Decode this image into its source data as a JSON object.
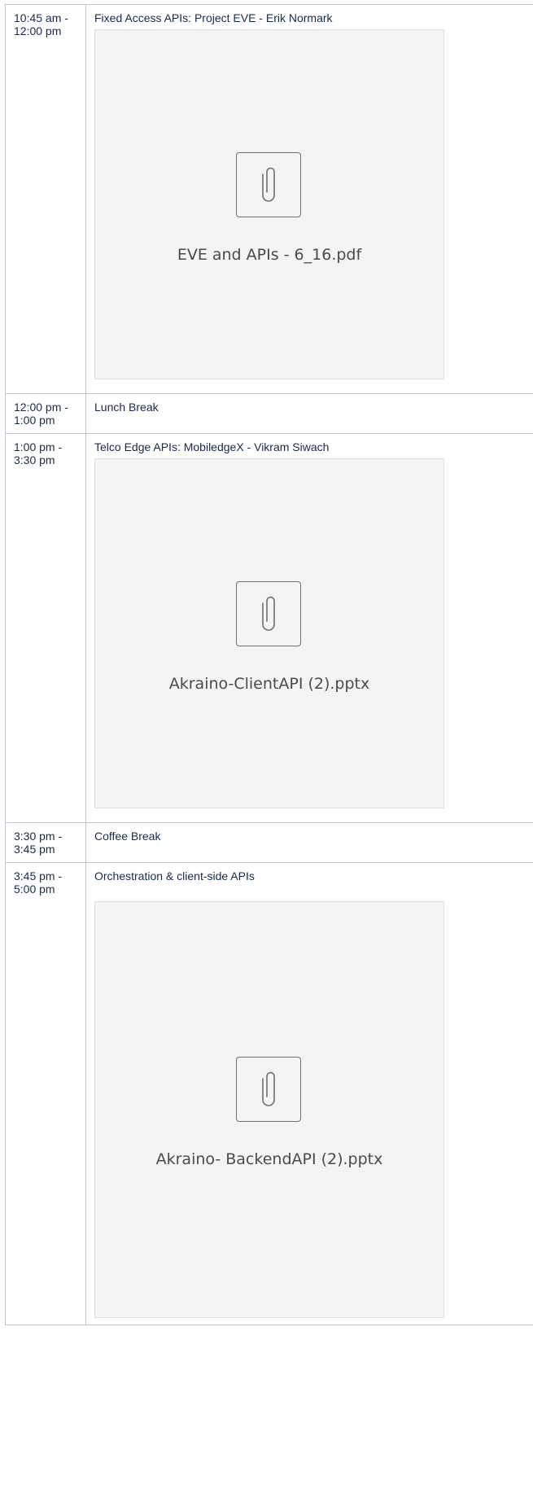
{
  "schedule": [
    {
      "time": "10:45 am - 12:00 pm",
      "session": "Fixed Access APIs: Project EVE - Erik Normark",
      "attachment": {
        "filename": "EVE and APIs - 6_16.pdf",
        "icon": "paperclip-icon"
      }
    },
    {
      "time": "12:00 pm - 1:00 pm",
      "session": "Lunch Break"
    },
    {
      "time": "1:00 pm - 3:30 pm",
      "session": "Telco Edge APIs: MobiledgeX - Vikram Siwach",
      "attachment": {
        "filename": "Akraino-ClientAPI (2).pptx",
        "icon": "paperclip-icon"
      }
    },
    {
      "time": "3:30 pm - 3:45 pm",
      "session": "Coffee Break"
    },
    {
      "time": "3:45 pm - 5:00 pm",
      "session": "Orchestration & client-side APIs",
      "attachment": {
        "filename": "Akraino- BackendAPI (2).pptx",
        "icon": "paperclip-icon"
      }
    }
  ],
  "colors": {
    "border": "#c1c7d0",
    "text": "#172b4d",
    "attachment_bg": "#f4f4f4",
    "icon_stroke": "#707070"
  }
}
